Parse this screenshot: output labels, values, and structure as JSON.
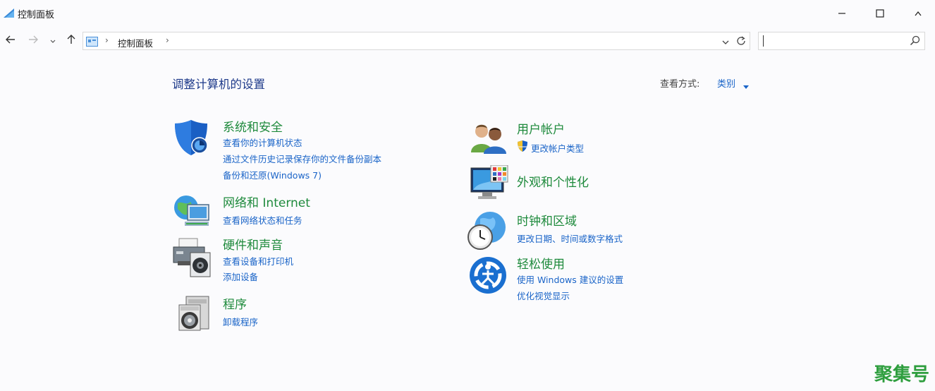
{
  "window": {
    "title": "控制面板",
    "minimize_icon": "minimize-icon",
    "maximize_icon": "maximize-icon",
    "close_icon": "close-icon"
  },
  "nav": {
    "back_icon": "back-arrow-icon",
    "forward_icon": "forward-arrow-icon",
    "recent_icon": "chevron-down-icon",
    "up_icon": "up-arrow-icon",
    "breadcrumb": [
      "控制面板"
    ],
    "search_value": "",
    "search_icon": "search-icon"
  },
  "page": {
    "heading": "调整计算机的设置",
    "view_by_label": "查看方式:",
    "view_by_value": "类别"
  },
  "categories": {
    "system": {
      "title": "系统和安全",
      "links": [
        "查看你的计算机状态",
        "通过文件历史记录保存你的文件备份副本",
        "备份和还原(Windows 7)"
      ],
      "icon": "shield-icon"
    },
    "network": {
      "title": "网络和 Internet",
      "links": [
        "查看网络状态和任务"
      ],
      "icon": "network-globe-icon"
    },
    "hardware": {
      "title": "硬件和声音",
      "links": [
        "查看设备和打印机",
        "添加设备"
      ],
      "icon": "printer-speaker-icon"
    },
    "programs": {
      "title": "程序",
      "links": [
        "卸载程序"
      ],
      "icon": "programs-disc-icon"
    },
    "users": {
      "title": "用户帐户",
      "links": [
        "更改帐户类型"
      ],
      "icon": "users-icon"
    },
    "appearance": {
      "title": "外观和个性化",
      "links": [],
      "icon": "monitor-palette-icon"
    },
    "clock": {
      "title": "时钟和区域",
      "links": [
        "更改日期、时间或数字格式"
      ],
      "icon": "clock-globe-icon"
    },
    "ease": {
      "title": "轻松使用",
      "links": [
        "使用 Windows 建议的设置",
        "优化视觉显示"
      ],
      "icon": "ease-of-access-icon"
    }
  },
  "watermark": "聚集号",
  "colors": {
    "heading": "#1e3a8a",
    "category_title": "#1e8a3c",
    "link": "#1a64c8",
    "watermark": "#2e9e3e"
  }
}
